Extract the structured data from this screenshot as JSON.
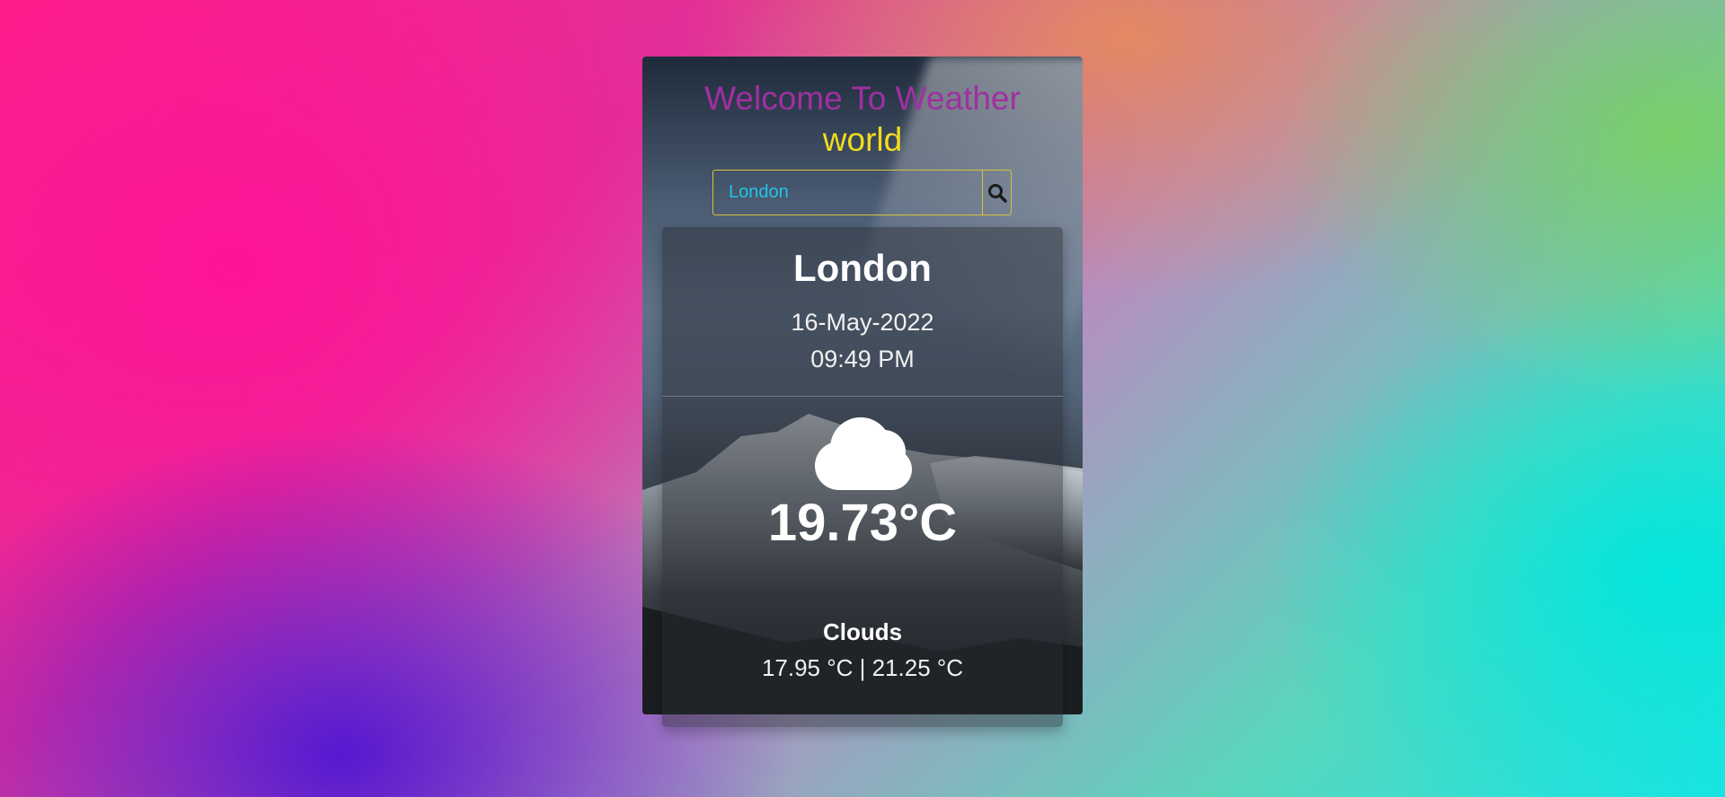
{
  "header": {
    "title_line1": "Welcome To Weather",
    "title_line2": "world"
  },
  "search": {
    "value": "London",
    "button_icon": "search-icon"
  },
  "weather": {
    "city": "London",
    "date": "16-May-2022",
    "time": "09:49 PM",
    "icon": "cloud-icon",
    "temperature": "19.73°C",
    "condition": "Clouds",
    "min_max": "17.95 °C | 21.25 °C"
  },
  "colors": {
    "title_primary": "#a12fa0",
    "title_secondary": "#f2dc1c",
    "search_border": "#d8c23a",
    "search_text": "#22c5e8"
  }
}
